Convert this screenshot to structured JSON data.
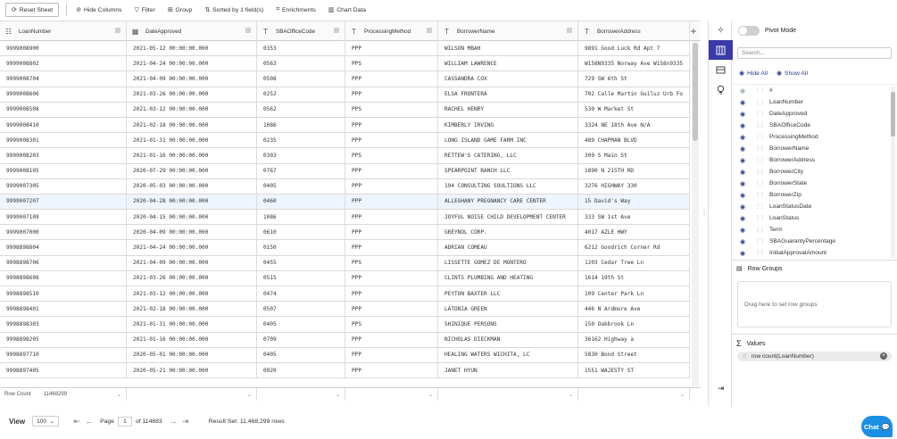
{
  "toolbar": {
    "reset": "Reset Sheet",
    "hide_columns": "Hide Columns",
    "filter": "Filter",
    "group": "Group",
    "sorted": "Sorted by 1 field(s)",
    "enrichments": "Enrichments",
    "chart_data": "Chart Data"
  },
  "columns": [
    {
      "name": "LoanNumber",
      "type_icon": "hash-icon"
    },
    {
      "name": "DateApproved",
      "type_icon": "calendar-icon"
    },
    {
      "name": "SBAOfficeCode",
      "type_icon": "text-icon"
    },
    {
      "name": "ProcessingMethod",
      "type_icon": "text-icon"
    },
    {
      "name": "BorrowerName",
      "type_icon": "text-icon"
    },
    {
      "name": "BorrowerAddress",
      "type_icon": "text-icon"
    }
  ],
  "rows": [
    [
      "9999008900",
      "2021-05-12 00:00:00.000",
      "0353",
      "PPP",
      "WILSON MBAH",
      "9891 Good Luck Rd Apt 7"
    ],
    [
      "9999008802",
      "2021-04-24 00:00:00.000",
      "0563",
      "PPS",
      "WILLIAM LAWRENCE",
      "W158N9335 Norway Ave W158n9335"
    ],
    [
      "9999008704",
      "2021-04-09 00:00:00.000",
      "0508",
      "PPP",
      "CASSANDRA COX",
      "729 SW 6th St"
    ],
    [
      "9999008606",
      "2021-03-26 00:00:00.000",
      "0252",
      "PPP",
      "ELSA FRONTERA",
      "702 Calle Martin Guiluz Urb Fo"
    ],
    [
      "9999008508",
      "2021-03-12 00:00:00.000",
      "0562",
      "PPS",
      "RACHEL HENRY",
      "530 W Market St"
    ],
    [
      "9999008410",
      "2021-02-18 00:00:00.000",
      "1086",
      "PPP",
      "KIMBERLY IRVING",
      "3324 NE 18th Ave N/A"
    ],
    [
      "9999008301",
      "2021-01-31 00:00:00.000",
      "0235",
      "PPP",
      "LONG ISLAND GAME FARM INC",
      "489 CHAPMAN BLVD"
    ],
    [
      "9999008203",
      "2021-01-16 00:00:00.000",
      "0303",
      "PPS",
      "RETTEW'S CATERING, LLC",
      "309 S Main St"
    ],
    [
      "9999008105",
      "2020-07-29 00:00:00.000",
      "0767",
      "PPP",
      "SPEARPOINT RANCH LLC",
      "1890 N 215TH RD"
    ],
    [
      "9999007305",
      "2020-05-03 00:00:00.000",
      "0405",
      "PPP",
      "194 CONSULTING SOULTIONS LLC",
      "3276 HIGHWAY 330"
    ],
    [
      "9999007207",
      "2020-04-28 00:00:00.000",
      "0460",
      "PPP",
      "ALLEGHANY PREGNANCY CARE CENTER",
      "15 David's Way"
    ],
    [
      "9999007109",
      "2020-04-15 00:00:00.000",
      "1086",
      "PPP",
      "JOYFUL NOISE CHILD DEVELOPMENT CENTER",
      "333 SW 1st Ave"
    ],
    [
      "9999007000",
      "2020-04-09 00:00:00.000",
      "0610",
      "PPP",
      "GREYNOL CORP.",
      "4017 AZLE HWY"
    ],
    [
      "9998898804",
      "2021-04-24 00:00:00.000",
      "0150",
      "PPP",
      "ADRIAN COMEAU",
      "6212 Goodrich Corner Rd"
    ],
    [
      "9998898706",
      "2021-04-09 00:00:00.000",
      "0455",
      "PPS",
      "LISSETTE GOMEZ DE MONTERO",
      "1203 Cedar Tree Ln"
    ],
    [
      "9998898608",
      "2021-03-26 00:00:00.000",
      "0515",
      "PPP",
      "CLINTS PLUMBING AND HEATING",
      "1614 19th St"
    ],
    [
      "9998898510",
      "2021-03-12 00:00:00.000",
      "0474",
      "PPP",
      "PEYTON BAXTER LLC",
      "109 Center Park Ln"
    ],
    [
      "9998898401",
      "2021-02-18 00:00:00.000",
      "0507",
      "PPP",
      "LATONIA GREEN",
      "446 N Ardmore Ave"
    ],
    [
      "9998898303",
      "2021-01-31 00:00:00.000",
      "0405",
      "PPS",
      "SHINIQUE PERSONS",
      "150 Oakbrook Ln"
    ],
    [
      "9998898205",
      "2021-01-16 00:00:00.000",
      "0709",
      "PPP",
      "NICHOLAS DIECKMAN",
      "36162 Highway a"
    ],
    [
      "9998897710",
      "2020-05-01 00:00:00.000",
      "0405",
      "PPP",
      "HEALING WATERS WICHITA, LC",
      "5830 Bond Street"
    ],
    [
      "9998897405",
      "2020-05-21 00:00:00.000",
      "0920",
      "PPP",
      "JANET HYUN",
      "1551 WAJESTY ST"
    ]
  ],
  "selected_row": 10,
  "footer": {
    "agg_label": "Row Count",
    "agg_value": "11468299"
  },
  "pager": {
    "view": "View",
    "page_size": "100",
    "page_label": "Page",
    "page": "1",
    "of": "of 114683",
    "result": "Result Set: 11,468,299 rows"
  },
  "panel": {
    "pivot_mode": "Pivot Mode",
    "search_placeholder": "Search...",
    "hide_all": "Hide All",
    "show_all": "Show All",
    "columns": [
      "#",
      "LoanNumber",
      "DateApproved",
      "SBAOfficeCode",
      "ProcessingMethod",
      "BorrowerName",
      "BorrowerAddress",
      "BorrowerCity",
      "BorrowerState",
      "BorrowerZip",
      "LoanStatusDate",
      "LoanStatus",
      "Term",
      "SBAGuarantyPercentage",
      "InitialApprovalAmount"
    ],
    "row_groups": "Row Groups",
    "row_groups_hint": "Drag here to set row groups",
    "values": "Values",
    "value_chip": "row count(LoanNumber)"
  },
  "chat": "Chat",
  "colors": {
    "accent": "#3a3aa8",
    "link": "#2b3a8c",
    "chat": "#1a8fe3",
    "selected_row": "#eef5fd"
  }
}
